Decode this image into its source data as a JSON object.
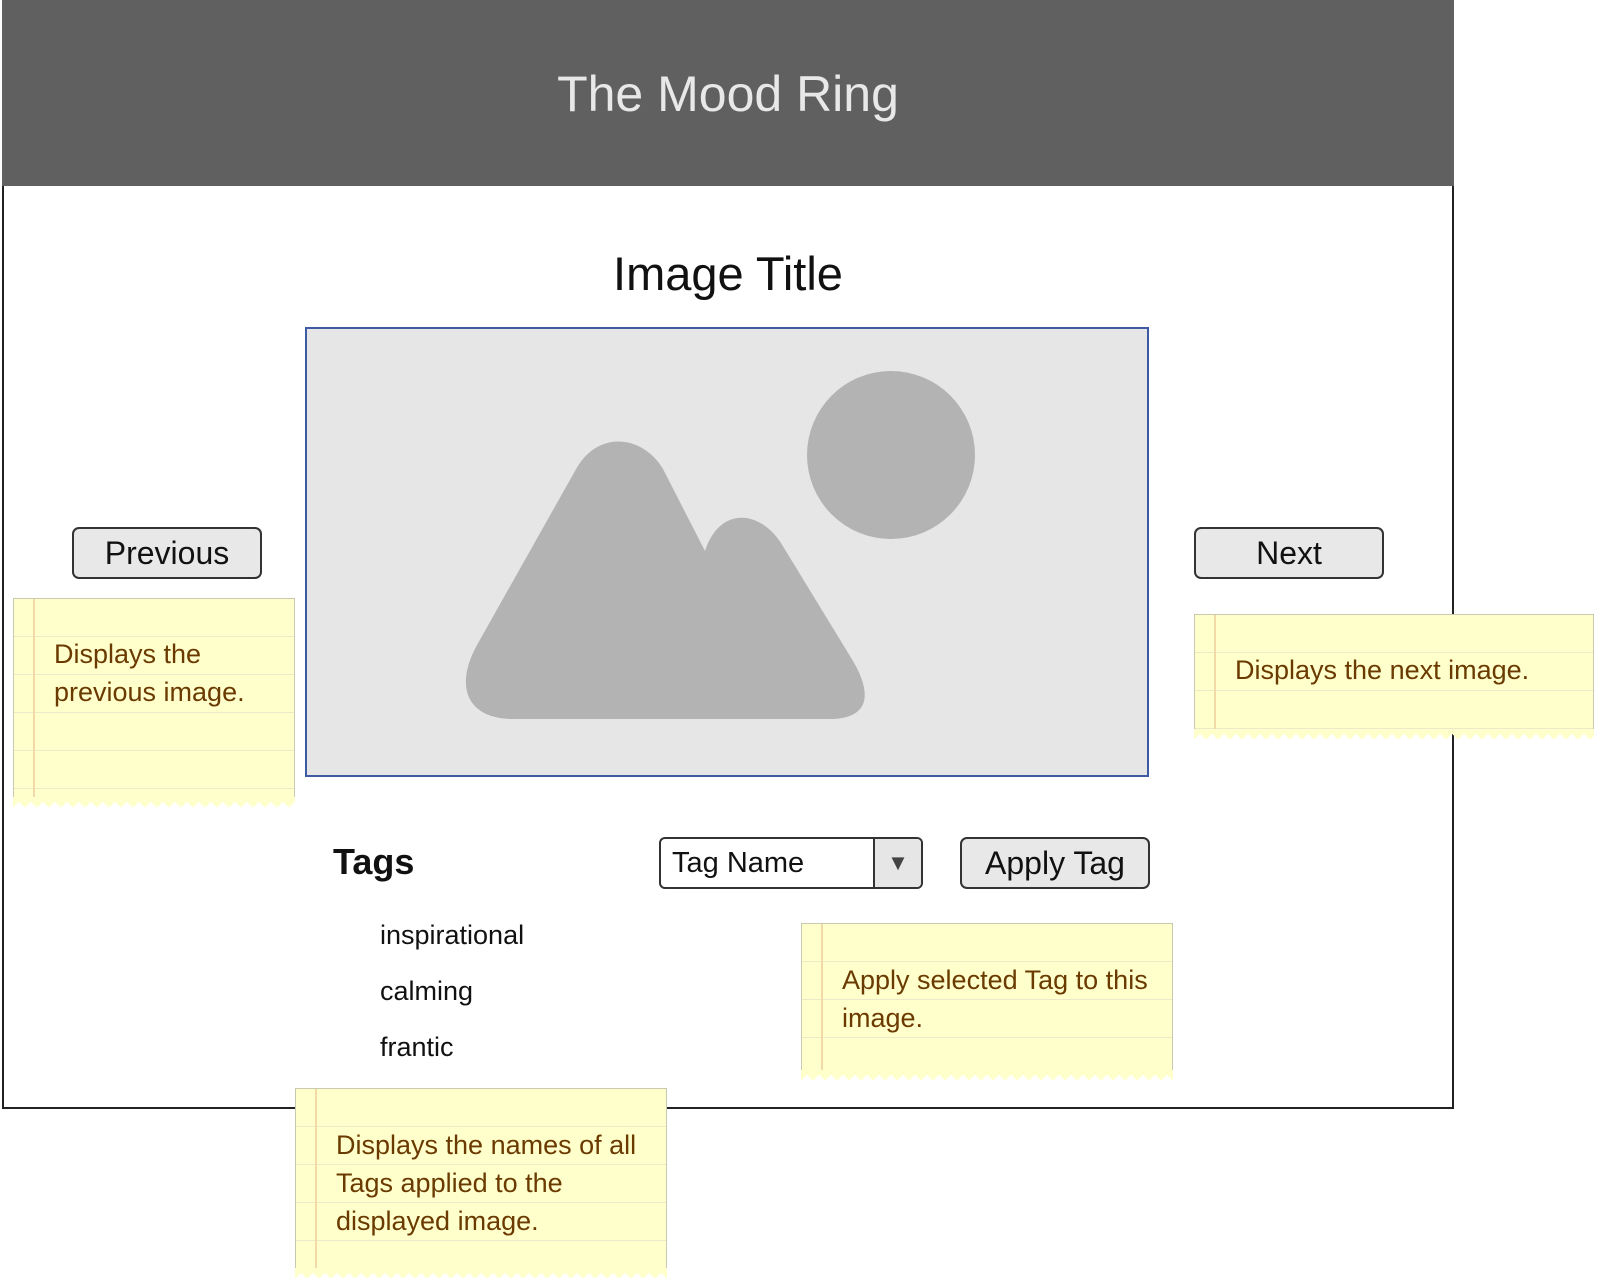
{
  "app": {
    "title": "The Mood Ring"
  },
  "viewer": {
    "image_title": "Image Title",
    "image_icon": "image-placeholder-icon",
    "previous_label": "Previous",
    "next_label": "Next"
  },
  "tags": {
    "heading": "Tags",
    "items": [
      "inspirational",
      "calming",
      "frantic"
    ],
    "select_value": "Tag Name",
    "select_arrow_icon": "triangle-down-icon",
    "apply_label": "Apply Tag"
  },
  "notes": {
    "previous": "Displays the previous image.",
    "next": "Displays the next image.",
    "apply": "Apply selected Tag to this image.",
    "tags": "Displays the names of all Tags applied to the displayed image."
  },
  "colors": {
    "header_background": "#606060",
    "header_text": "#e8e8e8",
    "image_border": "#3f5aa5",
    "image_background": "#e6e6e6",
    "image_shapes": "#b3b3b3",
    "note_background": "#ffffcc",
    "note_text": "#6a3a00",
    "button_background": "#e8e8e8"
  }
}
